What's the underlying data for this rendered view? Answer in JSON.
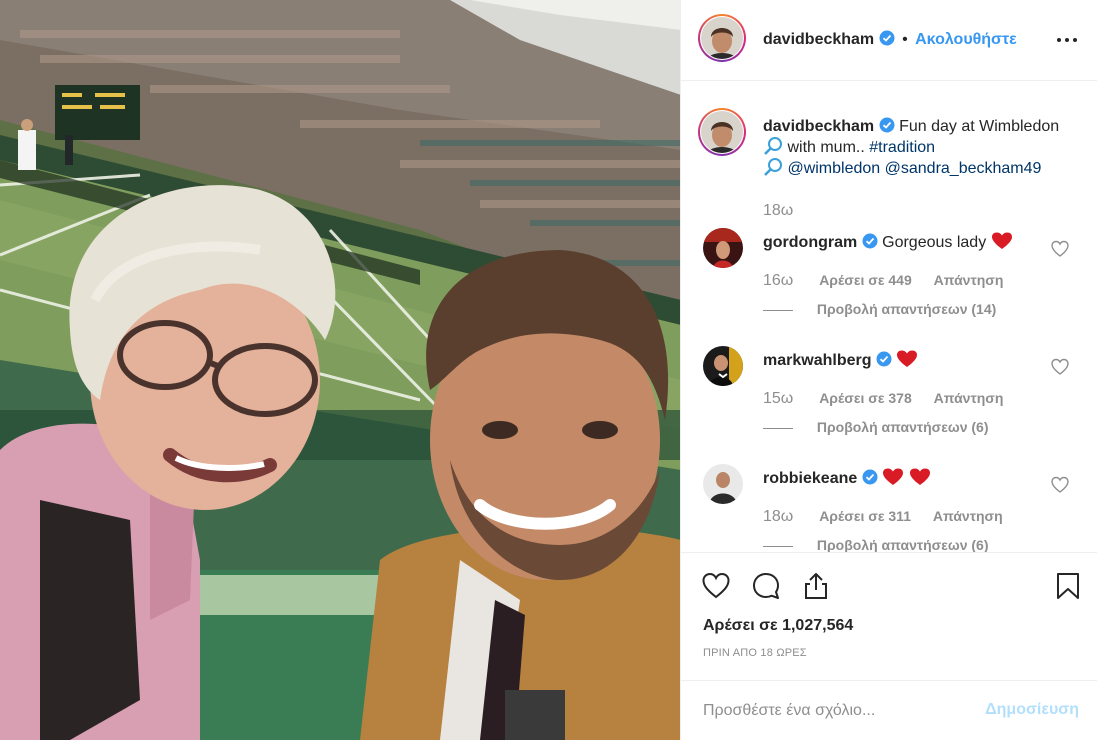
{
  "post": {
    "username": "davidbeckham",
    "follow_label": "Ακολουθήστε",
    "dot": "•",
    "caption_text": "Fun day at Wimbledon",
    "caption_mid": "with mum..",
    "hashtag": "#tradition",
    "mention1": "@wimbledon",
    "mention2": "@sandra_beckham49",
    "caption_time": "18ω"
  },
  "comments": [
    {
      "username": "gordongram",
      "text": "Gorgeous lady",
      "hearts": 1,
      "time": "16ω",
      "likes": "Αρέσει σε 449",
      "reply": "Απάντηση",
      "replies": "Προβολή απαντήσεων (14)"
    },
    {
      "username": "markwahlberg",
      "text": "",
      "hearts": 1,
      "time": "15ω",
      "likes": "Αρέσει σε 378",
      "reply": "Απάντηση",
      "replies": "Προβολή απαντήσεων (6)"
    },
    {
      "username": "robbiekeane",
      "text": "",
      "hearts": 2,
      "time": "18ω",
      "likes": "Αρέσει σε 311",
      "reply": "Απάντηση",
      "replies": "Προβολή απαντήσεων (6)"
    }
  ],
  "stats": {
    "likes_label": "Αρέσει σε 1,027,564",
    "time_ago": "ΠΡΙΝ ΑΠΟ 18 ΩΡΕΣ"
  },
  "composer": {
    "placeholder": "Προσθέστε ένα σχόλιο...",
    "post_label": "Δημοσίευση"
  },
  "colors": {
    "link": "#003569",
    "follow": "#3897f0",
    "muted": "#8e8e8e",
    "heart": "#ed4956",
    "post_disabled": "#b2dffc"
  },
  "icons": [
    "more-options-icon",
    "verified-icon",
    "heart-icon",
    "comment-icon",
    "share-icon",
    "bookmark-icon",
    "tennis-racket-icon",
    "red-heart-emoji"
  ]
}
